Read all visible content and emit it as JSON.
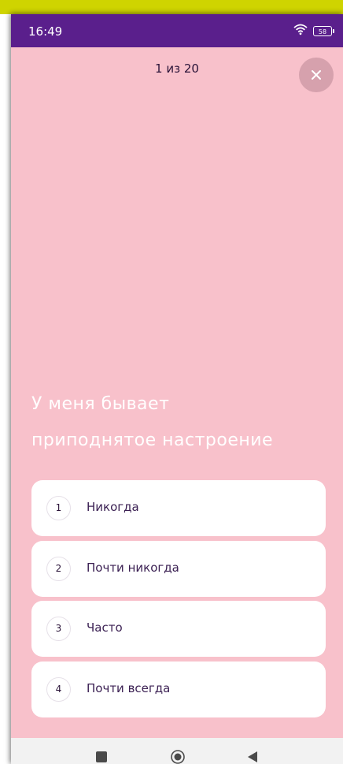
{
  "status_bar": {
    "time": "16:49",
    "battery": "58",
    "icons": [
      "wifi-icon",
      "battery-icon"
    ]
  },
  "header": {
    "progress": "1 из 20",
    "close_icon": "close-icon"
  },
  "question": {
    "line1": "У меня бывает",
    "line2": "приподнятое настроение"
  },
  "answers": [
    {
      "number": "1",
      "label": "Никогда"
    },
    {
      "number": "2",
      "label": "Почти никогда"
    },
    {
      "number": "3",
      "label": "Часто"
    },
    {
      "number": "4",
      "label": "Почти всегда"
    }
  ],
  "nav": {
    "icons": [
      "recents-icon",
      "home-icon",
      "back-icon"
    ]
  },
  "colors": {
    "status_bar": "#5a1f8c",
    "background": "#f8c1cb",
    "card": "#ffffff",
    "accent_strip": "#cfd400"
  }
}
